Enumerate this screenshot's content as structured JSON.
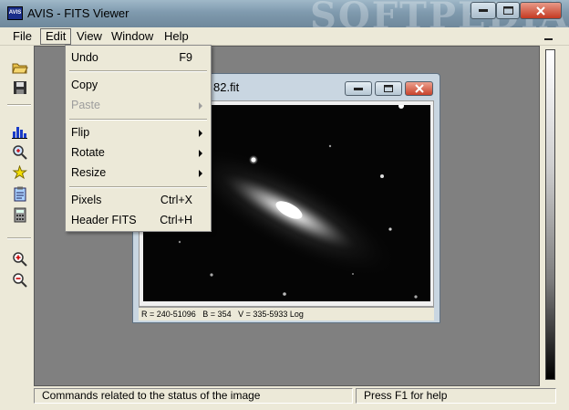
{
  "window": {
    "title": "AVIS - FITS Viewer",
    "app_icon_label": "AVIS",
    "watermark": "SOFTPEDIA"
  },
  "menubar": {
    "items": [
      {
        "label": "File"
      },
      {
        "label": "Edit"
      },
      {
        "label": "View"
      },
      {
        "label": "Window"
      },
      {
        "label": "Help"
      }
    ]
  },
  "edit_menu": {
    "undo": {
      "label": "Undo",
      "shortcut": "F9"
    },
    "copy": {
      "label": "Copy"
    },
    "paste": {
      "label": "Paste"
    },
    "flip": {
      "label": "Flip"
    },
    "rotate": {
      "label": "Rotate"
    },
    "resize": {
      "label": "Resize"
    },
    "pixels": {
      "label": "Pixels",
      "shortcut": "Ctrl+X"
    },
    "header": {
      "label": "Header FITS",
      "shortcut": "Ctrl+H"
    }
  },
  "toolbar": {
    "icons": [
      "open-folder-icon",
      "save-disk-icon",
      "histogram-icon",
      "zoom-scan-icon",
      "star-icon",
      "clipboard-icon",
      "calculator-icon",
      "zoom-in-icon",
      "zoom-out-icon"
    ]
  },
  "child_window": {
    "title": "82.fit",
    "status": "R = 240-51096   B = 354   V = 335-5933 Log"
  },
  "statusbar": {
    "message": "Commands related to the status of the image",
    "help": "Press F1 for help"
  },
  "colors": {
    "titlebar": "#7f9aae",
    "menu_bg": "#ece9d8",
    "client_bg": "#808080",
    "close_red": "#c43a22"
  }
}
